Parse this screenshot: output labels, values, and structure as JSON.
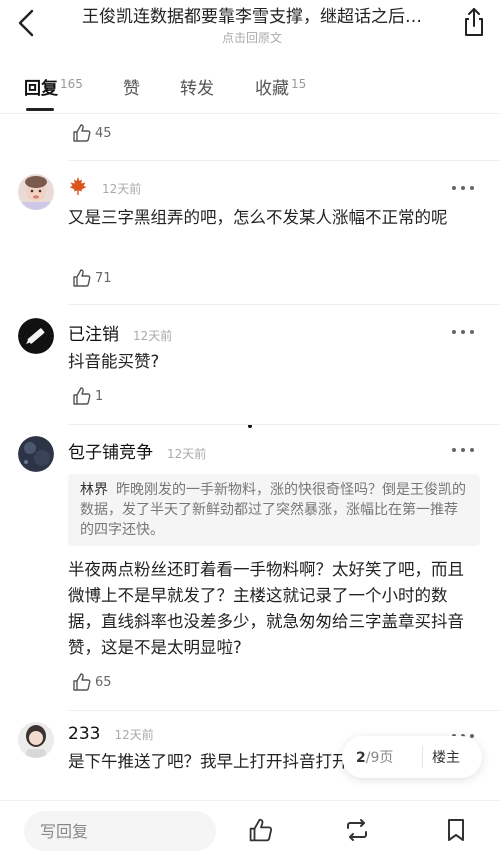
{
  "header": {
    "title": "王俊凯连数据都要靠李雪支撑，继超话之后…",
    "subtitle": "点击回原文"
  },
  "tabs": [
    {
      "label": "回复",
      "count": "165"
    },
    {
      "label": "赞",
      "count": ""
    },
    {
      "label": "转发",
      "count": ""
    },
    {
      "label": "收藏",
      "count": "15"
    }
  ],
  "top_like": {
    "count": "45"
  },
  "comments": [
    {
      "nick": "",
      "time": "12天前",
      "text": "又是三字黑组弄的吧，怎么不发某人涨幅不正常的呢",
      "likes": "71"
    },
    {
      "nick": "已注销",
      "time": "12天前",
      "text": "抖音能买赞?",
      "likes": "1"
    },
    {
      "nick": "包子铺竞争",
      "time": "12天前",
      "quote_name": "林界",
      "quote_text": "昨晚刚发的一手新物料，涨的快很奇怪吗？倒是王俊凯的数据，发了半天了新鲜劲都过了突然暴涨，涨幅比在第一推荐的四字还快。",
      "text": "半夜两点粉丝还盯着看一手物料啊？太好笑了吧，而且微博上不是早就发了？主楼这就记录了一个小时的数据，直线斜率也没差多少，就急匆匆给三字盖章买抖音赞，这是不是太明显啦?",
      "likes": "65"
    },
    {
      "nick": "233",
      "time": "12天前",
      "text": "是下午推送了吧？我早上打开抖音打开是推送三字"
    }
  ],
  "pager": {
    "current": "2",
    "total": "/9页",
    "op_label": "楼主"
  },
  "bottom": {
    "reply_placeholder": "写回复"
  },
  "colors": {
    "maple": "#d9541e",
    "accent": "#222222"
  },
  "icons": [
    "back-arrow-icon",
    "share-icon",
    "thumb-up-icon",
    "maple-leaf-icon",
    "repost-icon",
    "bookmark-icon"
  ]
}
